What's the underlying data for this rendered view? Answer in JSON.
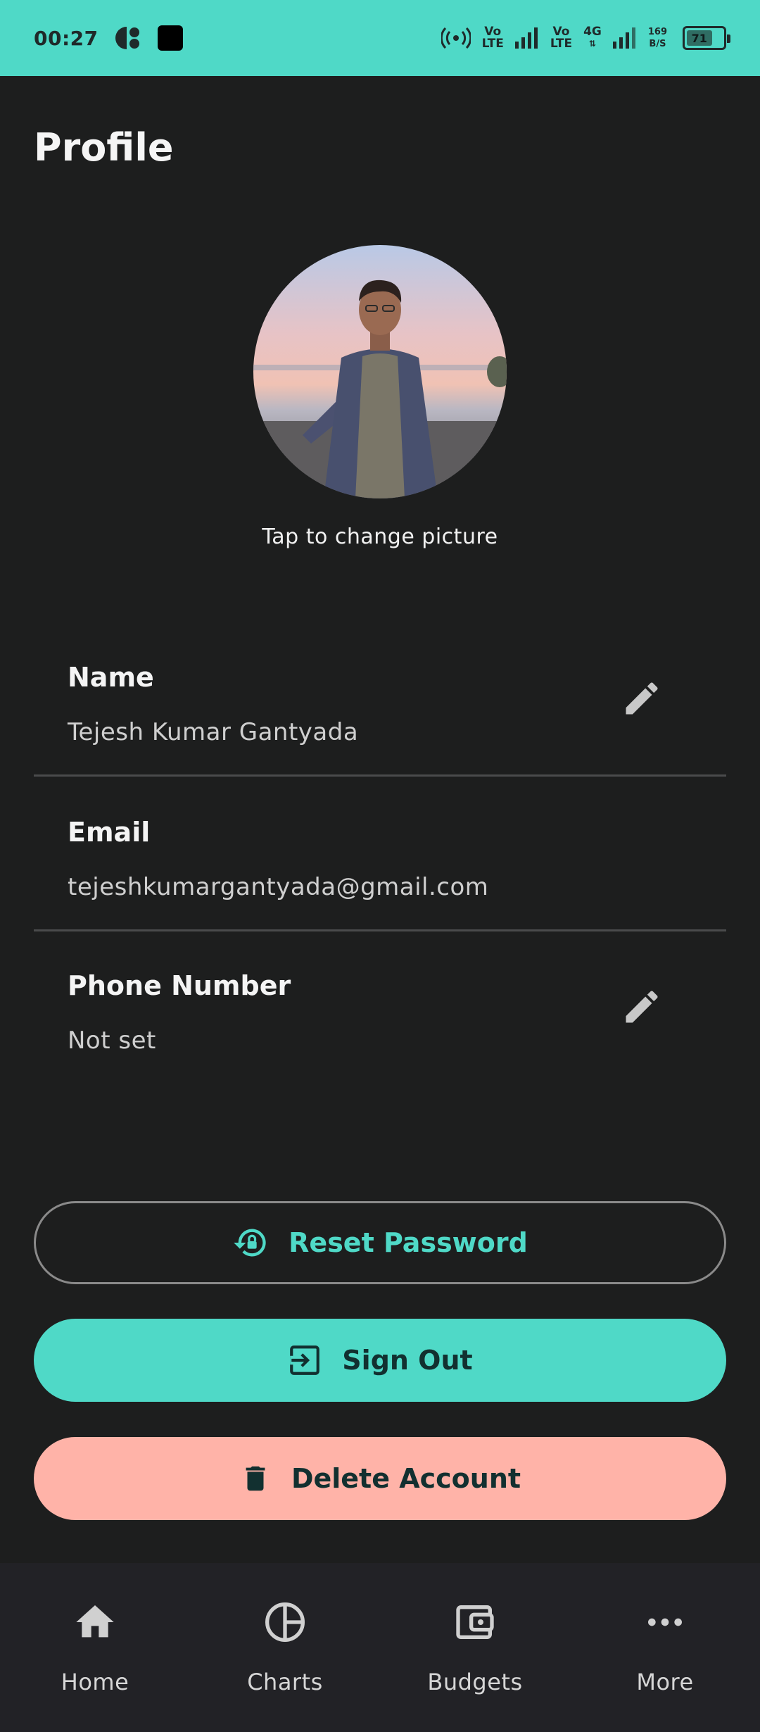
{
  "status_bar": {
    "time": "00:27",
    "net1": [
      "Vo",
      "LTE"
    ],
    "net2": [
      "Vo",
      "LTE"
    ],
    "net_type": "4G",
    "speed": [
      "169",
      "B/S"
    ],
    "battery_percent": 71,
    "battery_label": "71"
  },
  "header": {
    "title": "Profile"
  },
  "avatar": {
    "caption": "Tap to change picture"
  },
  "fields": {
    "name": {
      "label": "Name",
      "value": "Tejesh Kumar Gantyada"
    },
    "email": {
      "label": "Email",
      "value": "tejeshkumargantyada@gmail.com"
    },
    "phone": {
      "label": "Phone Number",
      "value": "Not set"
    }
  },
  "actions": {
    "reset_password": "Reset Password",
    "sign_out": "Sign Out",
    "delete_account": "Delete Account"
  },
  "nav": {
    "items": [
      {
        "label": "Home",
        "icon": "home-icon"
      },
      {
        "label": "Charts",
        "icon": "pie-chart-icon"
      },
      {
        "label": "Budgets",
        "icon": "wallet-icon"
      },
      {
        "label": "More",
        "icon": "more-horizontal-icon"
      }
    ]
  },
  "colors": {
    "accent": "#4fd9c7",
    "danger": "#ffb3a8",
    "background": "#1d1e1e",
    "nav_background": "#222226"
  }
}
